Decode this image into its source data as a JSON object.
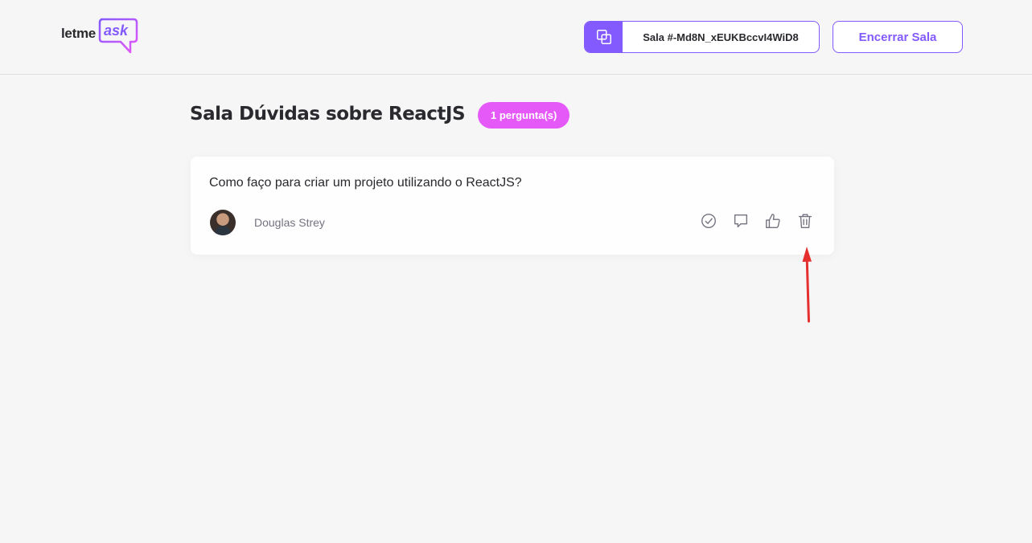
{
  "header": {
    "logo": {
      "prefix": "letme",
      "suffix": "ask"
    },
    "room_code": {
      "label": "Sala #-Md8N_xEUKBccvI4WiD8",
      "icon": "copy-icon"
    },
    "end_room_label": "Encerrar Sala"
  },
  "main": {
    "room_title": "Sala Dúvidas sobre ReactJS",
    "question_count_badge": "1 pergunta(s)",
    "questions": [
      {
        "content": "Como faço para criar um projeto utilizando o ReactJS?",
        "author": "Douglas Strey",
        "actions": [
          "check-icon",
          "answer-icon",
          "like-icon",
          "trash-icon"
        ]
      }
    ]
  },
  "colors": {
    "background": "#f6f6f6",
    "accent": "#835afd",
    "badge": "#e559f9",
    "annotation": "#e52e2e"
  }
}
